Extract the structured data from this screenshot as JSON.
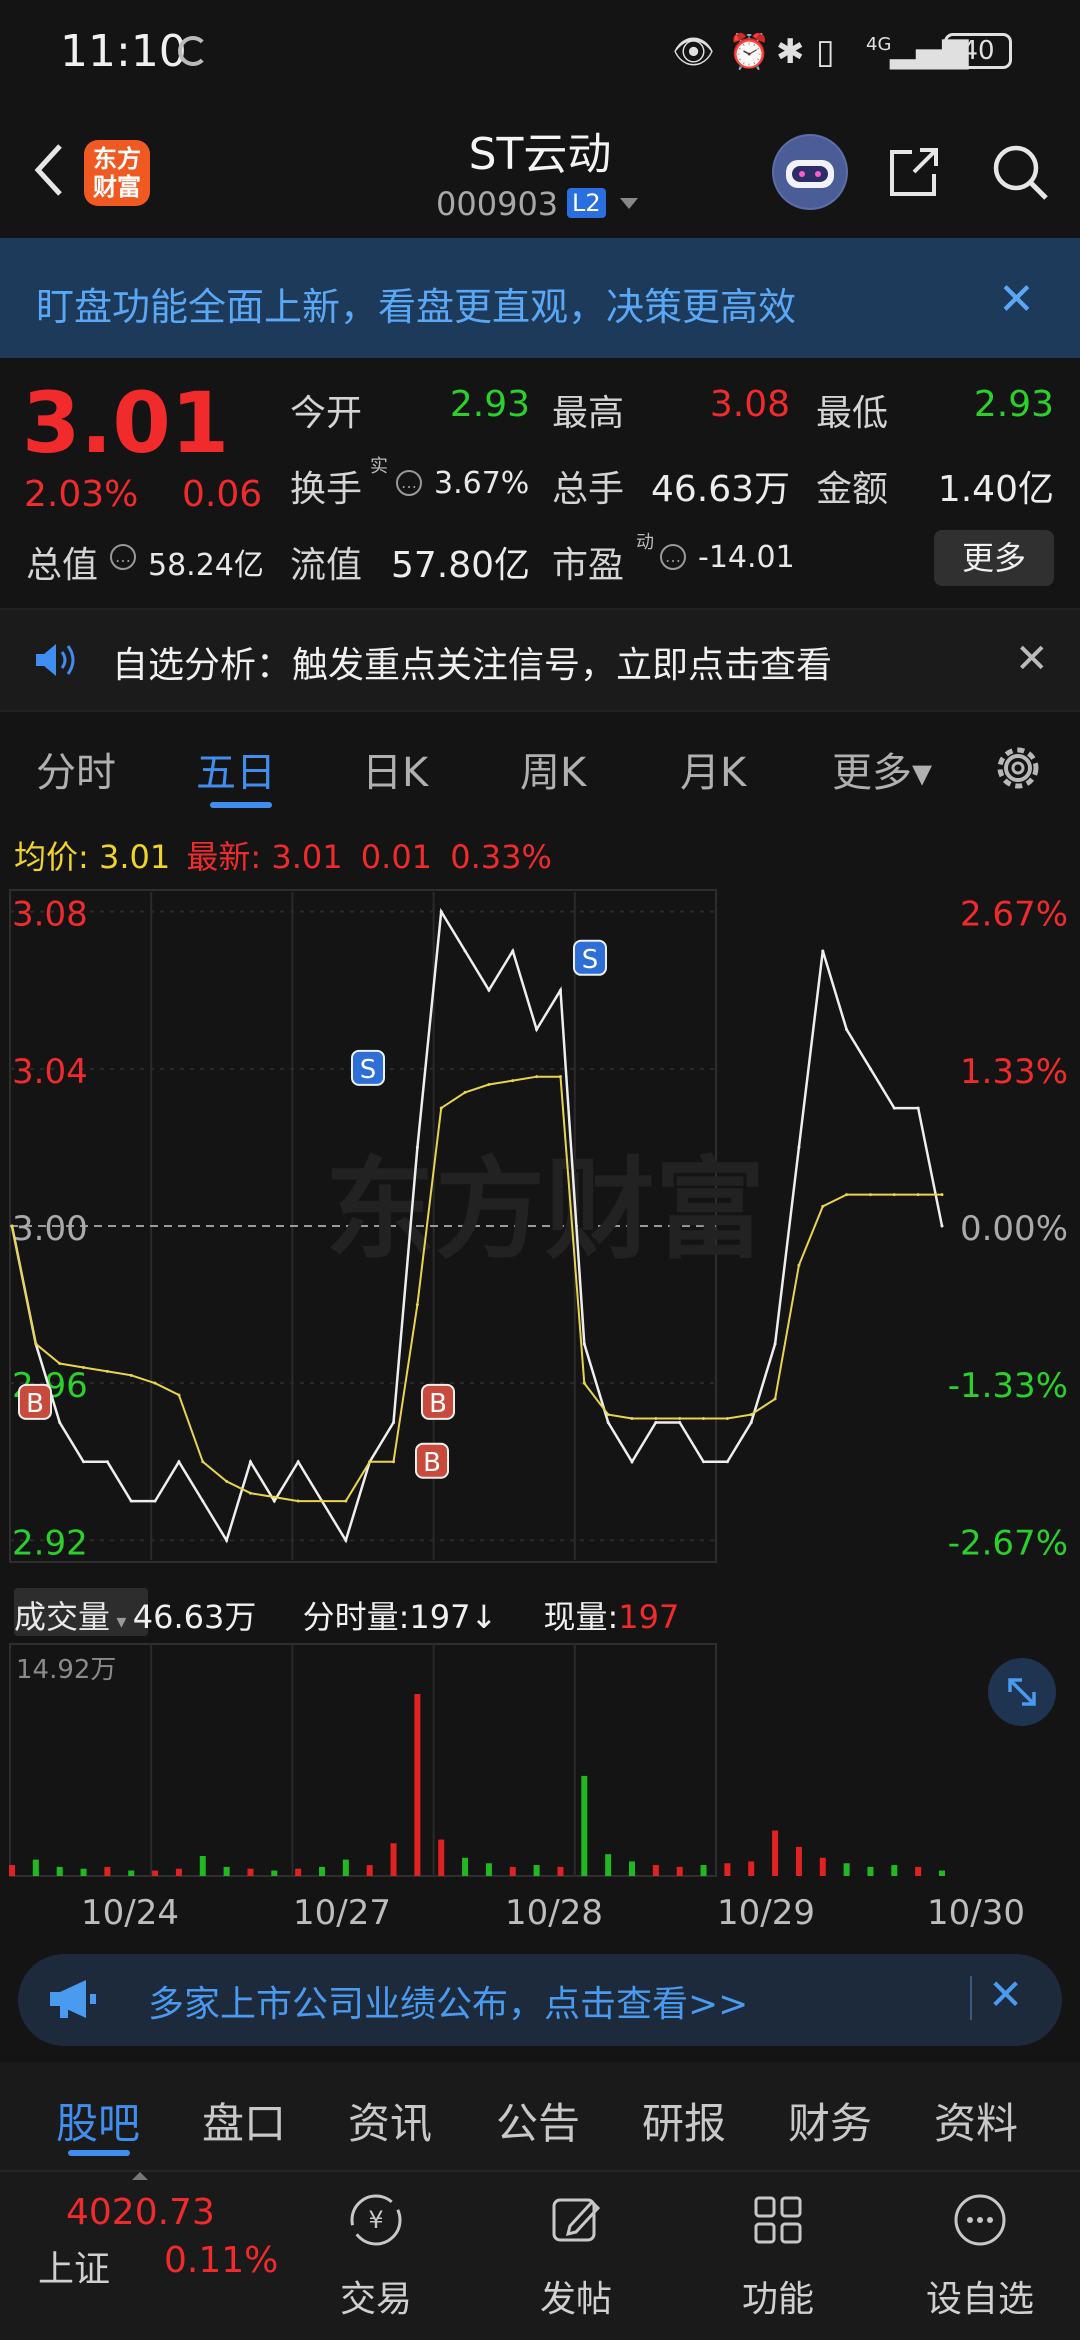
{
  "status_bar": {
    "time": "11:10",
    "battery": "40",
    "network": "4G"
  },
  "header": {
    "stock_name": "ST云动",
    "stock_code": "000903",
    "level_badge": "L2",
    "logo_line1": "东方",
    "logo_line2": "财富"
  },
  "banner": {
    "text": "盯盘功能全面上新，看盘更直观，决策更高效",
    "close": "✕"
  },
  "quote": {
    "price": "3.01",
    "change_pct": "2.03%",
    "change": "0.06",
    "open_label": "今开",
    "open": "2.93",
    "high_label": "最高",
    "high": "3.08",
    "low_label": "最低",
    "low": "2.93",
    "turnover_label": "换手",
    "turnover_sup": "实",
    "turnover": "3.67%",
    "volume_label": "总手",
    "volume": "46.63万",
    "amount_label": "金额",
    "amount": "1.40亿",
    "mktcap_label": "总值",
    "mktcap": "58.24亿",
    "float_label": "流值",
    "float_cap": "57.80亿",
    "pe_label": "市盈",
    "pe_sup": "动",
    "pe": "-14.01",
    "more_button": "更多"
  },
  "alert": {
    "text": "自选分析：触发重点关注信号，立即点击查看",
    "close": "✕"
  },
  "period_tabs": [
    {
      "label": "分时",
      "active": false
    },
    {
      "label": "五日",
      "active": true
    },
    {
      "label": "日K",
      "active": false
    },
    {
      "label": "周K",
      "active": false
    },
    {
      "label": "月K",
      "active": false
    },
    {
      "label": "更多▾",
      "active": false
    }
  ],
  "legend": {
    "avg_label": "均价:",
    "avg": "3.01",
    "latest_label": "最新:",
    "latest": "3.01",
    "latest_change": "0.01",
    "latest_pct": "0.33%"
  },
  "volume_header": {
    "dropdown": "成交量",
    "total": "46.63万",
    "tick_label": "分时量:",
    "tick_value": "197",
    "tick_arrow": "↓",
    "now_label": "现量:",
    "now_value": "197"
  },
  "watermark": "东方财富",
  "chart_data": {
    "type": "line",
    "title": "",
    "price_axis": {
      "ticks": [
        "3.08",
        "3.04",
        "3.00",
        "2.96",
        "2.92"
      ],
      "ylim": [
        2.915,
        3.085
      ],
      "prev_close": 3.0
    },
    "pct_axis": {
      "ticks": [
        "2.67%",
        "1.33%",
        "0.00%",
        "-1.33%",
        "-2.67%"
      ]
    },
    "x_labels": [
      "10/24",
      "10/27",
      "10/28",
      "10/29",
      "10/30"
    ],
    "series": [
      {
        "name": "最新",
        "color": "#eeeeee",
        "values": [
          3.0,
          2.97,
          2.95,
          2.94,
          2.94,
          2.93,
          2.93,
          2.94,
          2.93,
          2.92,
          2.94,
          2.93,
          2.94,
          2.93,
          2.92,
          2.94,
          2.95,
          3.02,
          3.08,
          3.07,
          3.06,
          3.07,
          3.05,
          3.06,
          2.97,
          2.95,
          2.94,
          2.95,
          2.95,
          2.94,
          2.94,
          2.95,
          2.97,
          3.02,
          3.07,
          3.05,
          3.04,
          3.03,
          3.03,
          3.0
        ]
      },
      {
        "name": "均价",
        "color": "#e8d44d",
        "values": [
          3.0,
          2.97,
          2.965,
          2.964,
          2.963,
          2.962,
          2.96,
          2.957,
          2.94,
          2.935,
          2.932,
          2.931,
          2.93,
          2.93,
          2.93,
          2.94,
          2.94,
          2.98,
          3.03,
          3.034,
          3.036,
          3.037,
          3.038,
          3.038,
          2.96,
          2.952,
          2.951,
          2.951,
          2.951,
          2.951,
          2.951,
          2.952,
          2.956,
          2.99,
          3.005,
          3.008,
          3.008,
          3.008,
          3.008,
          3.008
        ]
      }
    ],
    "markers": [
      {
        "label": "B",
        "day": 0
      },
      {
        "label": "S",
        "day": 2
      },
      {
        "label": "B",
        "day": 3
      },
      {
        "label": "B",
        "day": 3
      },
      {
        "label": "S",
        "day": 4
      }
    ],
    "volume": {
      "max_label": "14.92万",
      "values": [
        0.06,
        0.09,
        0.05,
        0.04,
        0.05,
        0.03,
        0.03,
        0.04,
        0.11,
        0.05,
        0.04,
        0.03,
        0.04,
        0.05,
        0.09,
        0.06,
        0.18,
        1.0,
        0.2,
        0.1,
        0.07,
        0.05,
        0.06,
        0.05,
        0.55,
        0.12,
        0.08,
        0.06,
        0.05,
        0.06,
        0.07,
        0.08,
        0.25,
        0.16,
        0.1,
        0.07,
        0.05,
        0.06,
        0.05,
        0.03
      ]
    }
  },
  "news": {
    "text": "多家上市公司业绩公布，点击查看>>",
    "close": "✕"
  },
  "section_tabs": [
    {
      "label": "股吧",
      "active": true
    },
    {
      "label": "盘口",
      "active": false
    },
    {
      "label": "资讯",
      "active": false
    },
    {
      "label": "公告",
      "active": false
    },
    {
      "label": "研报",
      "active": false
    },
    {
      "label": "财务",
      "active": false
    },
    {
      "label": "资料",
      "active": false
    }
  ],
  "bottom_nav": {
    "index_name": "上证",
    "index_value": "4020.73",
    "index_pct": "0.11%",
    "items": [
      {
        "label": "交易"
      },
      {
        "label": "发帖"
      },
      {
        "label": "功能"
      },
      {
        "label": "设自选"
      }
    ]
  },
  "colors": {
    "up": "#f12b2b",
    "down": "#2bd12b",
    "accent": "#3f8ef0",
    "avg_line": "#e8d44d"
  }
}
